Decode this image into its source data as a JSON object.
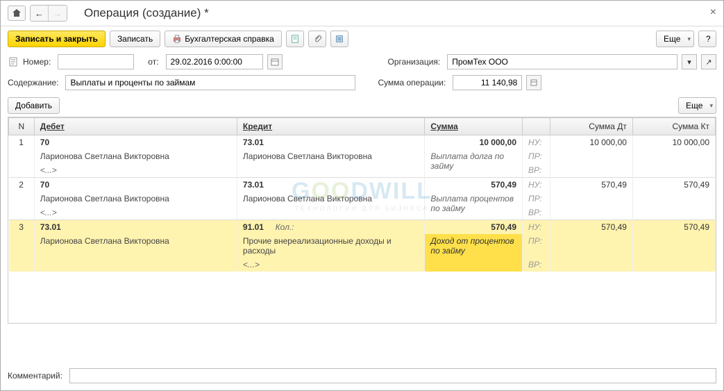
{
  "title": "Операция (создание) *",
  "toolbar": {
    "save_close": "Записать и закрыть",
    "save": "Записать",
    "accounting_ref": "Бухгалтерская справка",
    "more": "Еще",
    "help": "?"
  },
  "form": {
    "number_label": "Номер:",
    "number_value": "",
    "date_label": "от:",
    "date_value": "29.02.2016 0:00:00",
    "org_label": "Организация:",
    "org_value": "ПромТех ООО",
    "content_label": "Содержание:",
    "content_value": "Выплаты и проценты по займам",
    "sum_label": "Сумма операции:",
    "sum_value": "11 140,98"
  },
  "subtoolbar": {
    "add": "Добавить",
    "more": "Еще"
  },
  "columns": {
    "n": "N",
    "debit": "Дебет",
    "credit": "Кредит",
    "sum": "Сумма",
    "sum_dt": "Сумма Дт",
    "sum_kt": "Сумма Кт"
  },
  "tags": {
    "nu": "НУ:",
    "pr": "ПР:",
    "vr": "ВР:"
  },
  "rows": [
    {
      "n": "1",
      "debit_acc": "70",
      "debit_sub": "Ларионова Светлана Викторовна",
      "debit_ext": "<...>",
      "credit_acc": "73.01",
      "credit_sub": "Ларионова Светлана Викторовна",
      "credit_ext": "",
      "sum": "10 000,00",
      "sum_note": "Выплата долга по займу",
      "dt": "10 000,00",
      "kt": "10 000,00"
    },
    {
      "n": "2",
      "debit_acc": "70",
      "debit_sub": "Ларионова Светлана Викторовна",
      "debit_ext": "<...>",
      "credit_acc": "73.01",
      "credit_sub": "Ларионова Светлана Викторовна",
      "credit_ext": "",
      "sum": "570,49",
      "sum_note": "Выплата процентов по займу",
      "dt": "570,49",
      "kt": "570,49"
    },
    {
      "n": "3",
      "debit_acc": "73.01",
      "debit_sub": "Ларионова Светлана Викторовна",
      "debit_ext": "",
      "credit_acc": "91.01",
      "credit_qty": "Кол.:",
      "credit_sub": "Прочие внереализационные доходы и расходы",
      "credit_ext": "<...>",
      "sum": "570,49",
      "sum_note": "Доход от процентов по займу",
      "dt": "570,49",
      "kt": "570,49"
    }
  ],
  "footer": {
    "comment_label": "Комментарий:",
    "comment_value": ""
  },
  "watermark": {
    "line1a": "G",
    "line1b": "OO",
    "line1c": "DWILL",
    "line2": "ТЕХНОЛОГИИ ДЛЯ БИЗНЕСА"
  }
}
